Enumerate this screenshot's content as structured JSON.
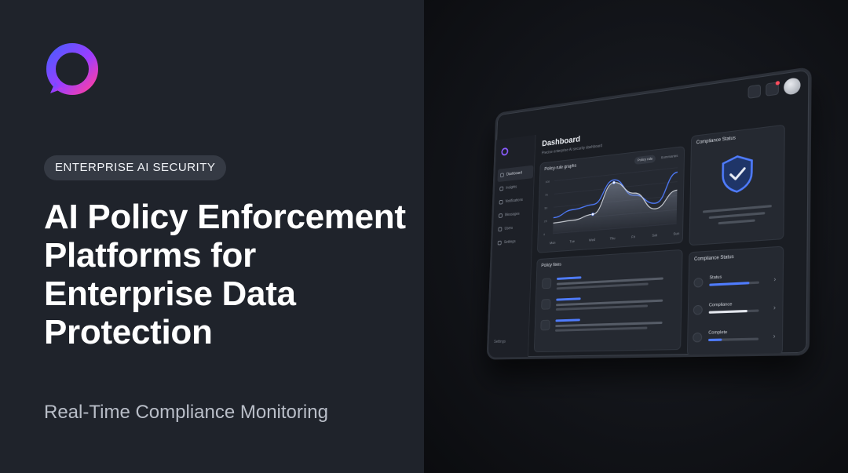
{
  "hero": {
    "badge": "ENTERPRISE AI SECURITY",
    "headline": "AI Policy Enforcement Platforms for Enterprise Data Protection",
    "subheadline": "Real-Time Compliance Monitoring",
    "logo_icon": "ring-logo-icon",
    "accent_gradient": [
      "#4f5bff",
      "#b53cff",
      "#ff3fa4"
    ]
  },
  "dashboard": {
    "title": "Dashboard",
    "subtitle": "Precise enterprise AI security dashboard",
    "sidebar": {
      "items": [
        {
          "label": "Dashboard",
          "icon": "grid-icon",
          "active": true
        },
        {
          "label": "Insights",
          "icon": "user-icon",
          "active": false
        },
        {
          "label": "Notifications",
          "icon": "bell-icon",
          "active": false
        },
        {
          "label": "Messages",
          "icon": "message-icon",
          "active": false
        },
        {
          "label": "Users",
          "icon": "list-icon",
          "active": false
        },
        {
          "label": "Settings",
          "icon": "gear-icon",
          "active": false
        }
      ],
      "footer_label": "Settings"
    },
    "chart_card": {
      "title": "Policy-rule graphs",
      "chip_active": "Policy rule",
      "chip_alt": "Summaries"
    },
    "policy_card": {
      "title": "Policy fixes"
    },
    "compliance_top": {
      "title": "Compliance Status",
      "icon": "shield-check-icon"
    },
    "compliance_list": {
      "title": "Compliance Status",
      "rows": [
        {
          "label": "Status",
          "progress": 0.8,
          "color": "#4f7cff"
        },
        {
          "label": "Compliance",
          "progress": 0.78,
          "color": "#e4e7ee"
        },
        {
          "label": "Complete",
          "progress": 0.28,
          "color": "#4f7cff"
        }
      ]
    }
  },
  "chart_data": {
    "type": "area",
    "categories": [
      "Mon",
      "Tue",
      "Wed",
      "Thu",
      "Fri",
      "Sat",
      "Sun"
    ],
    "yticks": [
      0,
      25,
      50,
      75,
      100
    ],
    "ylim": [
      0,
      100
    ],
    "series": [
      {
        "values": [
          30,
          42,
          48,
          90,
          58,
          40,
          92
        ],
        "color": "#4f7cff"
      },
      {
        "values": [
          20,
          22,
          30,
          85,
          62,
          30,
          60
        ],
        "color": "#cfd3da"
      }
    ]
  }
}
